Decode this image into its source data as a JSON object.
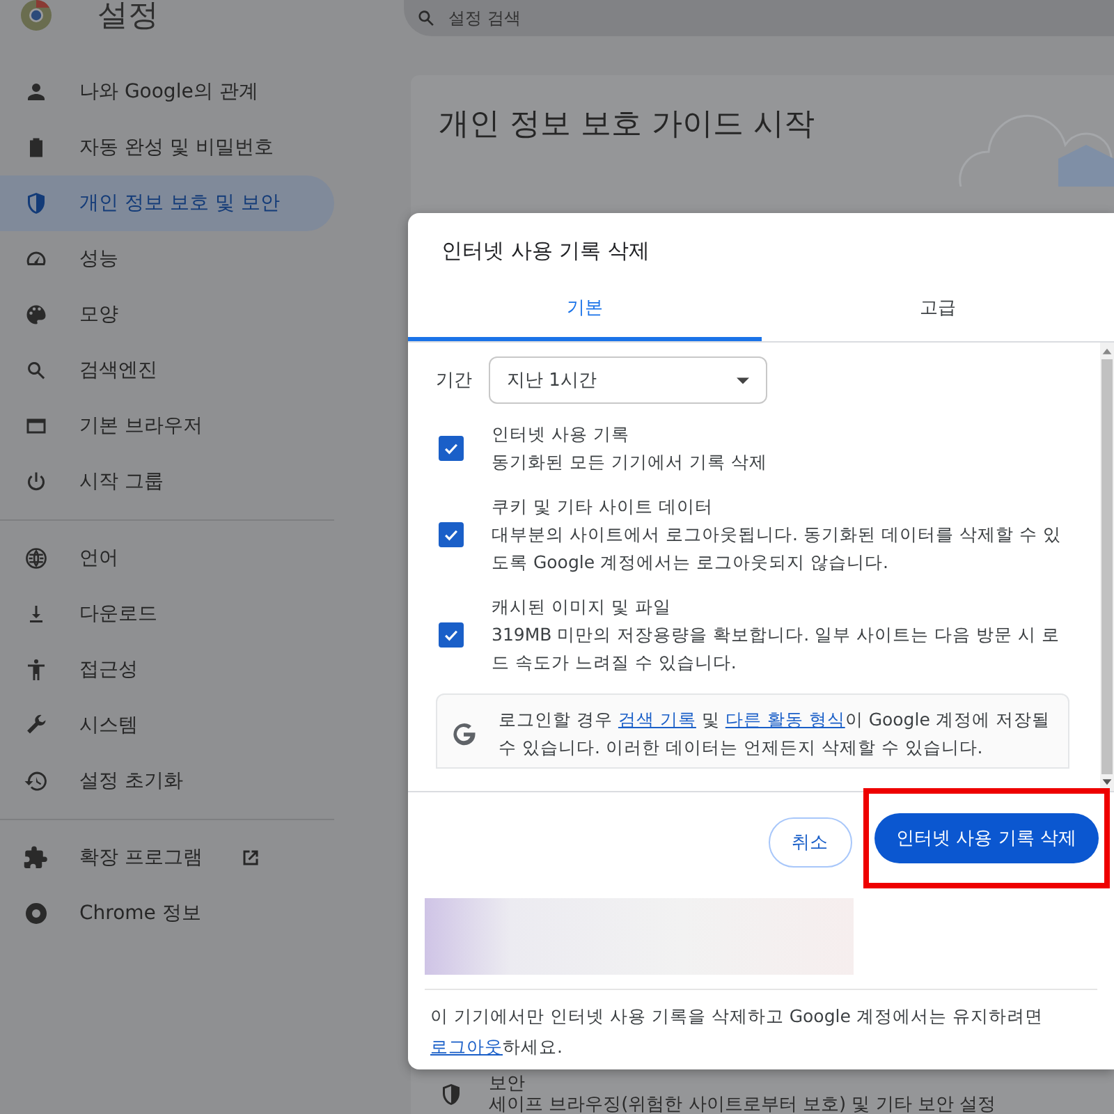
{
  "header": {
    "title": "설정",
    "search": {
      "placeholder": "설정 검색"
    }
  },
  "sidebar": {
    "groups": [
      [
        {
          "label": "나와 Google의 관계",
          "selected": false,
          "external": false
        },
        {
          "label": "자동 완성 및 비밀번호",
          "selected": false,
          "external": false
        },
        {
          "label": "개인 정보 보호 및 보안",
          "selected": true,
          "external": false
        },
        {
          "label": "성능",
          "selected": false,
          "external": false
        },
        {
          "label": "모양",
          "selected": false,
          "external": false
        },
        {
          "label": "검색엔진",
          "selected": false,
          "external": false
        },
        {
          "label": "기본 브라우저",
          "selected": false,
          "external": false
        },
        {
          "label": "시작 그룹",
          "selected": false,
          "external": false
        }
      ],
      [
        {
          "label": "언어",
          "selected": false,
          "external": false
        },
        {
          "label": "다운로드",
          "selected": false,
          "external": false
        },
        {
          "label": "접근성",
          "selected": false,
          "external": false
        },
        {
          "label": "시스템",
          "selected": false,
          "external": false
        },
        {
          "label": "설정 초기화",
          "selected": false,
          "external": false
        }
      ],
      [
        {
          "label": "확장 프로그램",
          "selected": false,
          "external": true
        },
        {
          "label": "Chrome 정보",
          "selected": false,
          "external": false
        }
      ]
    ]
  },
  "main": {
    "card_title": "개인 정보 보호 가이드 시작",
    "security_row": {
      "title": "보안",
      "subtitle": "세이프 브라우징(위험한 사이트로부터 보호) 및 기타 보안 설정"
    }
  },
  "dialog": {
    "title": "인터넷 사용 기록 삭제",
    "tabs": [
      {
        "label": "기본",
        "selected": true
      },
      {
        "label": "고급",
        "selected": false
      }
    ],
    "time_range": {
      "label": "기간",
      "value": "지난 1시간"
    },
    "options": [
      {
        "title": "인터넷 사용 기록",
        "description": "동기화된 모든 기기에서 기록 삭제",
        "checked": true
      },
      {
        "title": "쿠키 및 기타 사이트 데이터",
        "description": "대부분의 사이트에서 로그아웃됩니다. 동기화된 데이터를 삭제할 수 있도록 Google 계정에서는 로그아웃되지 않습니다.",
        "checked": true
      },
      {
        "title": "캐시된 이미지 및 파일",
        "description": "319MB 미만의 저장용량을 확보합니다. 일부 사이트는 다음 방문 시 로드 속도가 느려질 수 있습니다.",
        "checked": true
      }
    ],
    "info": [
      {
        "kind": "text",
        "text": "로그인할 경우 "
      },
      {
        "kind": "link",
        "text": "검색 기록"
      },
      {
        "kind": "text",
        "text": " 및 "
      },
      {
        "kind": "link",
        "text": "다른 활동 형식"
      },
      {
        "kind": "text",
        "text": "이 Google 계정에 저장될 수 있습니다. 이러한 데이터는 언제든지 삭제할 수 있습니다."
      }
    ],
    "buttons": [
      {
        "label": "취소",
        "kind": "outline",
        "highlighted": false
      },
      {
        "label": "인터넷 사용 기록 삭제",
        "kind": "primary",
        "highlighted": true
      }
    ],
    "note": [
      {
        "kind": "text",
        "text": "이 기기에서만 인터넷 사용 기록을 삭제하고 Google 계정에서는 유지하려면 "
      },
      {
        "kind": "link",
        "text": "로그아웃"
      },
      {
        "kind": "text",
        "text": "하세요."
      }
    ]
  }
}
